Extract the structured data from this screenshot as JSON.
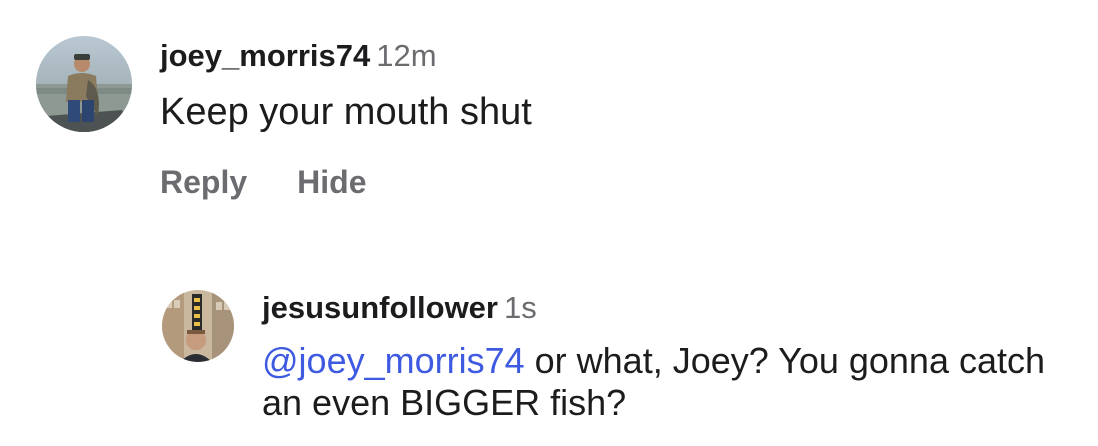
{
  "comments": [
    {
      "username": "joey_morris74",
      "time": "12m",
      "text": "Keep your mouth shut",
      "actions": {
        "reply": "Reply",
        "hide": "Hide"
      }
    },
    {
      "username": "jesusunfollower",
      "time": "1s",
      "mention": "@joey_morris74",
      "text": " or what, Joey? You gonna catch an even BIGGER fish?"
    }
  ],
  "icons": {
    "avatar_1": "user-avatar-fisherman",
    "avatar_2": "user-avatar-street"
  }
}
